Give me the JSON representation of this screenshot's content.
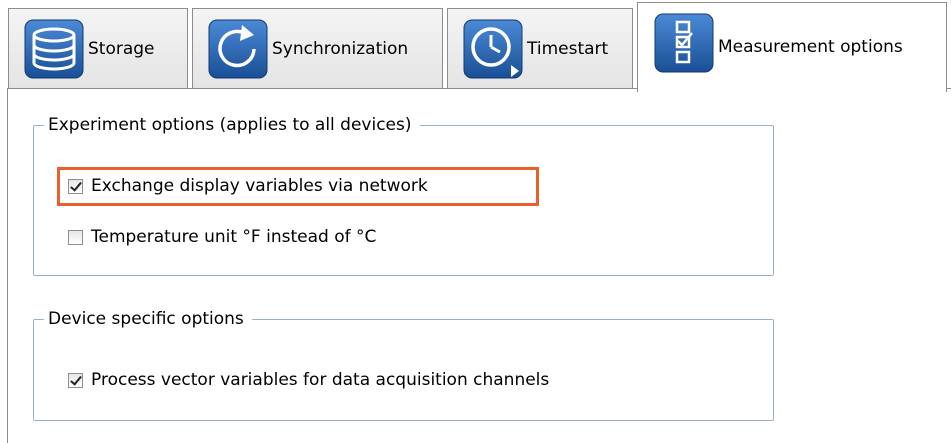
{
  "tabs": [
    {
      "label": "Storage",
      "icon": "storage-icon",
      "active": false
    },
    {
      "label": "Synchronization",
      "icon": "synchronization-icon",
      "active": false
    },
    {
      "label": "Timestart",
      "icon": "timestart-icon",
      "active": false
    },
    {
      "label": "Measurement options",
      "icon": "checklist-icon",
      "active": true
    }
  ],
  "experiment_group": {
    "title": "Experiment options (applies to all devices)",
    "options": [
      {
        "label": "Exchange display variables via network",
        "checked": true,
        "enabled": true,
        "highlighted": true
      },
      {
        "label": "Temperature unit °F instead of °C",
        "checked": false,
        "enabled": true
      }
    ]
  },
  "device_group": {
    "title": "Device specific options",
    "options": [
      {
        "label": "Process vector variables for data acquisition channels",
        "checked": true,
        "enabled": true
      }
    ]
  },
  "colors": {
    "icon_blue": "#1f5fa8",
    "highlight": "#e8602c",
    "group_border": "#9ab0c8"
  }
}
